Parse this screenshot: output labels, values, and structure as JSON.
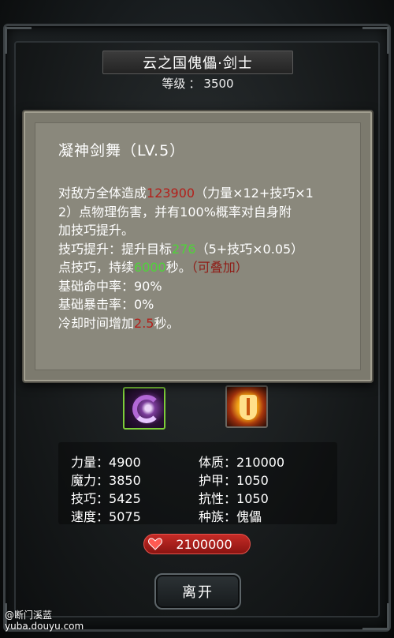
{
  "header": {
    "title": "云之国傀儡·剑士",
    "level_label": "等级",
    "level_sep": "：",
    "level_value": "3500"
  },
  "skill_tooltip": {
    "title": "凝神剑舞（LV.5）",
    "line1_a": "对敌方全体造成",
    "line1_damage": "123900",
    "line1_b": "（力量×12+技巧×1",
    "line2": "2）点物理伤害，并有100%概率对自身附",
    "line3": "加技巧提升。",
    "line4_a": "技巧提升：提升目标",
    "line4_value": "276",
    "line4_b": "（5+技巧×0.05）",
    "line5_a": "点技巧，持续",
    "line5_duration": "6000",
    "line5_b": "秒。",
    "line5_stack": "（可叠加）",
    "line6": "基础命中率：90%",
    "line7": "基础暴击率：0%",
    "line8_a": "冷却时间增加",
    "line8_value": "2.5",
    "line8_b": "秒。"
  },
  "skills": [
    {
      "icon": "purple-swirl-blade-icon",
      "selected": true
    },
    {
      "icon": "golden-shield-icon",
      "selected": false
    }
  ],
  "stats": {
    "left": [
      {
        "label": "力量",
        "value": "4900"
      },
      {
        "label": "魔力",
        "value": "3850"
      },
      {
        "label": "技巧",
        "value": "5425"
      },
      {
        "label": "速度",
        "value": "5075"
      }
    ],
    "right": [
      {
        "label": "体质",
        "value": "210000"
      },
      {
        "label": "护甲",
        "value": "1050"
      },
      {
        "label": "抗性",
        "value": "1050"
      },
      {
        "label": "种族",
        "value": "傀儡"
      }
    ],
    "sep": "："
  },
  "hp": {
    "icon": "heart-icon",
    "value": "2100000"
  },
  "buttons": {
    "leave_label": "离开"
  },
  "watermark": {
    "line1": "@断门溪蓝",
    "line2": "yuba.douyu.com"
  },
  "colors": {
    "damage_red": "#b3201b",
    "buff_green": "#4fd33a",
    "stack_red": "#8f1d17",
    "hp_pill": "#c62b26",
    "tooltip_bg": "#8a887c"
  }
}
